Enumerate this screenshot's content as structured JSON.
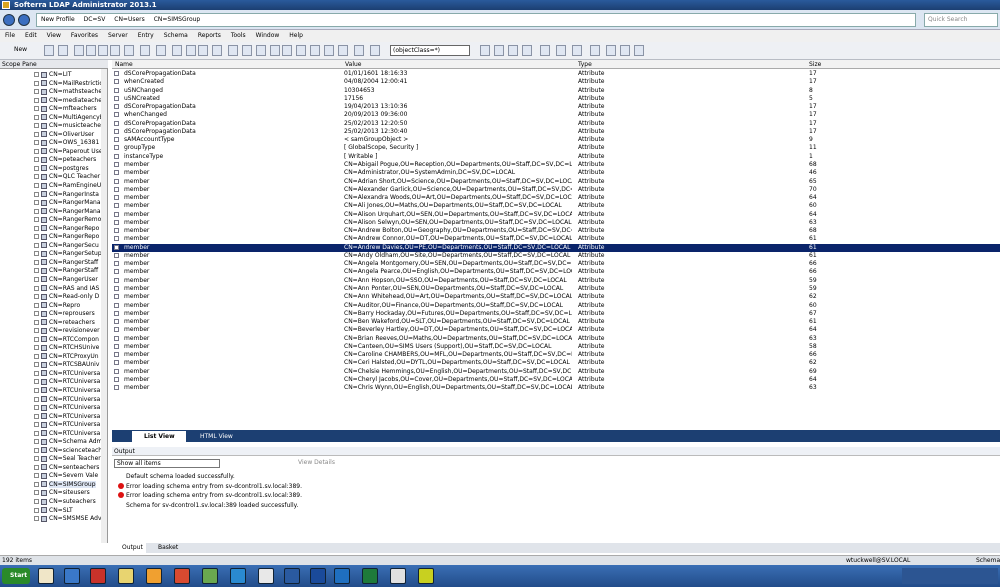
{
  "window": {
    "title": "Softerra LDAP Administrator 2013.1"
  },
  "breadcrumb": {
    "items": [
      "New Profile",
      "DC=SV",
      "CN=Users",
      "CN=SIMSGroup"
    ],
    "search_placeholder": "Quick Search"
  },
  "menu": [
    "File",
    "Edit",
    "View",
    "Favorites",
    "Server",
    "Entry",
    "Schema",
    "Reports",
    "Tools",
    "Window",
    "Help"
  ],
  "toolbar": {
    "new_label": "New",
    "filter": "(objectClass=*)"
  },
  "scope": {
    "title": "Scope Pane",
    "items": [
      "CN=LIT",
      "CN=MailRestrictio",
      "CN=mathsteache",
      "CN=mediateache",
      "CN=mfteachers",
      "CN=MultiAgencyE",
      "CN=musicteacher",
      "CN=OliverUser",
      "CN=OWS_16381",
      "CN=Paperout Use",
      "CN=peteachers",
      "CN=postgres",
      "CN=QLC Teacher",
      "CN=RamEngineU",
      "CN=RangerInsta",
      "CN=RangerMana",
      "CN=RangerMana",
      "CN=RangerRemo",
      "CN=RangerRepo",
      "CN=RangerRepo",
      "CN=RangerSecu",
      "CN=RangerSetup",
      "CN=RangerStaff",
      "CN=RangerStaff",
      "CN=RangerUser",
      "CN=RAS and IAS",
      "CN=Read-only D",
      "CN=Repro",
      "CN=reprousers",
      "CN=reteachers",
      "CN=revisionever",
      "CN=RTCCompon",
      "CN=RTCHSUnive",
      "CN=RTCProxyUn",
      "CN=RTCSBAUniv",
      "CN=RTCUniversa",
      "CN=RTCUniversa",
      "CN=RTCUniversa",
      "CN=RTCUniversa",
      "CN=RTCUniversa",
      "CN=RTCUniversa",
      "CN=RTCUniversa",
      "CN=RTCUniversa",
      "CN=Schema Adm",
      "CN=scienceteach",
      "CN=Seal Teacher",
      "CN=senteachers",
      "CN=Severn Vale",
      "CN=SIMSGroup",
      "CN=siteusers",
      "CN=suteachers",
      "CN=SLT",
      "CN=SMSMSE Adv"
    ],
    "selected": 48
  },
  "grid": {
    "columns": [
      "Name",
      "Value",
      "Type",
      "Size"
    ],
    "rows": [
      [
        "dSCorePropagationData",
        "01/01/1601 18:16:33",
        "Attribute",
        "17"
      ],
      [
        "whenCreated",
        "04/08/2004 12:00:41",
        "Attribute",
        "17"
      ],
      [
        "uSNChanged",
        "10304653",
        "Attribute",
        "8"
      ],
      [
        "uSNCreated",
        "17156",
        "Attribute",
        "5"
      ],
      [
        "dSCorePropagationData",
        "19/04/2013 13:10:36",
        "Attribute",
        "17"
      ],
      [
        "whenChanged",
        "20/09/2013 09:36:00",
        "Attribute",
        "17"
      ],
      [
        "dSCorePropagationData",
        "25/02/2013 12:20:50",
        "Attribute",
        "17"
      ],
      [
        "dSCorePropagationData",
        "25/02/2013 12:30:40",
        "Attribute",
        "17"
      ],
      [
        "sAMAccountType",
        "< samGroupObject >",
        "Attribute",
        "9"
      ],
      [
        "groupType",
        "[ GlobalScope, Security ]",
        "Attribute",
        "11"
      ],
      [
        "instanceType",
        "[ Writable ]",
        "Attribute",
        "1"
      ],
      [
        "member",
        "CN=Abigail Pogue,OU=Reception,OU=Departments,OU=Staff,DC=SV,DC=LOCAL",
        "Attribute",
        "68"
      ],
      [
        "member",
        "CN=Administrator,OU=SystemAdmin,DC=SV,DC=LOCAL",
        "Attribute",
        "46"
      ],
      [
        "member",
        "CN=Adrian Short,OU=Science,OU=Departments,OU=Staff,DC=SV,DC=LOCAL",
        "Attribute",
        "65"
      ],
      [
        "member",
        "CN=Alexander Garlick,OU=Science,OU=Departments,OU=Staff,DC=SV,DC=LOCAL",
        "Attribute",
        "70"
      ],
      [
        "member",
        "CN=Alexandra Woods,OU=Art,OU=Departments,OU=Staff,DC=SV,DC=LOCAL",
        "Attribute",
        "64"
      ],
      [
        "member",
        "CN=Ali Jones,OU=Maths,OU=Departments,OU=Staff,DC=SV,DC=LOCAL",
        "Attribute",
        "60"
      ],
      [
        "member",
        "CN=Alison Urquhart,OU=SEN,OU=Departments,OU=Staff,DC=SV,DC=LOCAL",
        "Attribute",
        "64"
      ],
      [
        "member",
        "CN=Alison Selwyn,OU=SEN,OU=Departments,OU=Staff,DC=SV,DC=LOCAL",
        "Attribute",
        "63"
      ],
      [
        "member",
        "CN=Andrew Bolton,OU=Geography,OU=Departments,OU=Staff,DC=SV,DC=LOCAL",
        "Attribute",
        "68"
      ],
      [
        "member",
        "CN=Andrew Connor,OU=DT,OU=Departments,OU=Staff,DC=SV,DC=LOCAL",
        "Attribute",
        "61"
      ],
      [
        "member",
        "CN=Andrew Davies,OU=PE,OU=Departments,OU=Staff,DC=SV,DC=LOCAL",
        "Attribute",
        "61"
      ],
      [
        "member",
        "CN=Andy Oldham,OU=Site,OU=Departments,OU=Staff,DC=SV,DC=LOCAL",
        "Attribute",
        "61"
      ],
      [
        "member",
        "CN=Angela Montgomery,OU=SEN,OU=Departments,OU=Staff,DC=SV,DC=LOCAL",
        "Attribute",
        "66"
      ],
      [
        "member",
        "CN=Angela Pearce,OU=English,OU=Departments,OU=Staff,DC=SV,DC=LOCAL",
        "Attribute",
        "66"
      ],
      [
        "member",
        "CN=Ann Hopson,OU=SSO,OU=Departments,OU=Staff,DC=SV,DC=LOCAL",
        "Attribute",
        "59"
      ],
      [
        "member",
        "CN=Ann Ponter,OU=SEN,OU=Departments,OU=Staff,DC=SV,DC=LOCAL",
        "Attribute",
        "59"
      ],
      [
        "member",
        "CN=Ann Whitehead,OU=Art,OU=Departments,OU=Staff,DC=SV,DC=LOCAL",
        "Attribute",
        "62"
      ],
      [
        "member",
        "CN=Auditor,OU=Finance,OU=Departments,OU=Staff,DC=SV,DC=LOCAL",
        "Attribute",
        "60"
      ],
      [
        "member",
        "CN=Barry Hockaday,OU=Futures,OU=Departments,OU=Staff,DC=SV,DC=LOCAL",
        "Attribute",
        "67"
      ],
      [
        "member",
        "CN=Ben Wakeford,OU=SLT,OU=Departments,OU=Staff,DC=SV,DC=LOCAL",
        "Attribute",
        "61"
      ],
      [
        "member",
        "CN=Beverley Hartley,OU=DT,OU=Departments,OU=Staff,DC=SV,DC=LOCAL",
        "Attribute",
        "64"
      ],
      [
        "member",
        "CN=Brian Reeves,OU=Maths,OU=Departments,OU=Staff,DC=SV,DC=LOCAL",
        "Attribute",
        "63"
      ],
      [
        "member",
        "CN=Canteen,OU=SIMS Users (Support),OU=Staff,DC=SV,DC=LOCAL",
        "Attribute",
        "58"
      ],
      [
        "member",
        "CN=Caroline CHAMBERS,OU=MFL,OU=Departments,OU=Staff,DC=SV,DC=LOCAL",
        "Attribute",
        "66"
      ],
      [
        "member",
        "CN=Ceri Halsted,OU=DYTL,OU=Departments,OU=Staff,DC=SV,DC=LOCAL",
        "Attribute",
        "62"
      ],
      [
        "member",
        "CN=Chelsie Hemmings,OU=English,OU=Departments,OU=Staff,DC=SV,DC=LOCAL",
        "Attribute",
        "69"
      ],
      [
        "member",
        "CN=Cheryl Jacobs,OU=Cover,OU=Departments,OU=Staff,DC=SV,DC=LOCAL",
        "Attribute",
        "64"
      ],
      [
        "member",
        "CN=Chris Wynn,OU=English,OU=Departments,OU=Staff,DC=SV,DC=LOCAL",
        "Attribute",
        "63"
      ]
    ],
    "selected": 21
  },
  "view_tabs": {
    "list": "List View",
    "html": "HTML View"
  },
  "output": {
    "title": "Output",
    "filter": "Show all items",
    "view_details": "View Details",
    "log": [
      {
        "kind": "info",
        "text": "Default schema loaded successfully."
      },
      {
        "kind": "error",
        "text": "Error loading schema entry from sv-dcontrol1.sv.local:389."
      },
      {
        "kind": "error",
        "text": "Error loading schema entry from sv-dcontrol1.sv.local:389."
      },
      {
        "kind": "info",
        "text": "Schema for sv-dcontrol1.sv.local:389 loaded successfully."
      }
    ]
  },
  "bottom_tabs": {
    "output": "Output",
    "basket": "Basket"
  },
  "status": {
    "count": "192 items",
    "user": "wtuckwell@SV.LOCAL",
    "mode": "Schema"
  },
  "taskbar": {
    "start": "Start"
  }
}
